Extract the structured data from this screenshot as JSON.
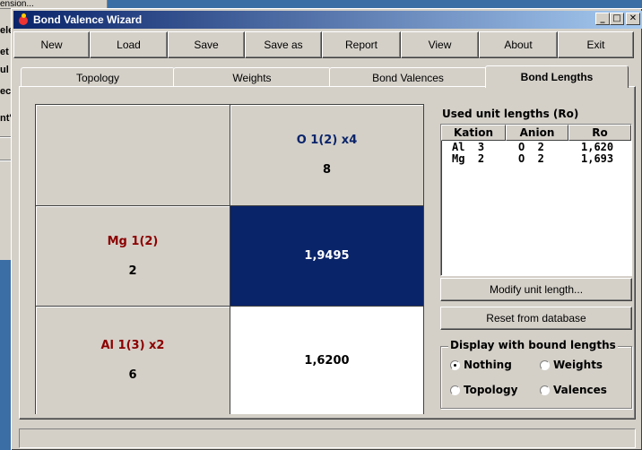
{
  "background_window": {
    "top_fragment": "ension...",
    "fragments": [
      "ele",
      "et",
      "ul",
      "ec",
      "nt'"
    ]
  },
  "window": {
    "title": "Bond Valence Wizard",
    "controls": {
      "minimize": "_",
      "maximize": "□",
      "close": "✕"
    }
  },
  "toolbar": [
    {
      "label": "New"
    },
    {
      "label": "Load"
    },
    {
      "label": "Save"
    },
    {
      "label": "Save as"
    },
    {
      "label": "Report"
    },
    {
      "label": "View"
    },
    {
      "label": "About"
    },
    {
      "label": "Exit"
    }
  ],
  "tabs": [
    {
      "label": "Topology",
      "active": false
    },
    {
      "label": "Weights",
      "active": false
    },
    {
      "label": "Bond Valences",
      "active": false
    },
    {
      "label": "Bond Lengths",
      "active": true
    }
  ],
  "grid": {
    "anion_header": {
      "name": "O 1(2) x4",
      "count": "8"
    },
    "rows": [
      {
        "name": "Mg 1(2)",
        "count": "2",
        "value": "1,9495"
      },
      {
        "name": "Al 1(3) x2",
        "count": "6",
        "value": "1,6200"
      }
    ]
  },
  "unit_lengths": {
    "title": "Used unit lengths (Ro)",
    "columns": [
      "Kation",
      "Anion",
      "Ro"
    ],
    "rows": [
      {
        "kation": "Al  3",
        "anion": "O  2",
        "ro": "1,620"
      },
      {
        "kation": "Mg  2",
        "anion": "O  2",
        "ro": "1,693"
      }
    ]
  },
  "buttons": {
    "modify": "Modify unit length...",
    "reset": "Reset from database"
  },
  "display_group": {
    "legend": "Display with bound lengths",
    "options": [
      {
        "label": "Nothing",
        "checked": true
      },
      {
        "label": "Weights",
        "checked": false
      },
      {
        "label": "Topology",
        "checked": false
      },
      {
        "label": "Valences",
        "checked": false
      }
    ]
  },
  "statusbar": {
    "text": ""
  }
}
